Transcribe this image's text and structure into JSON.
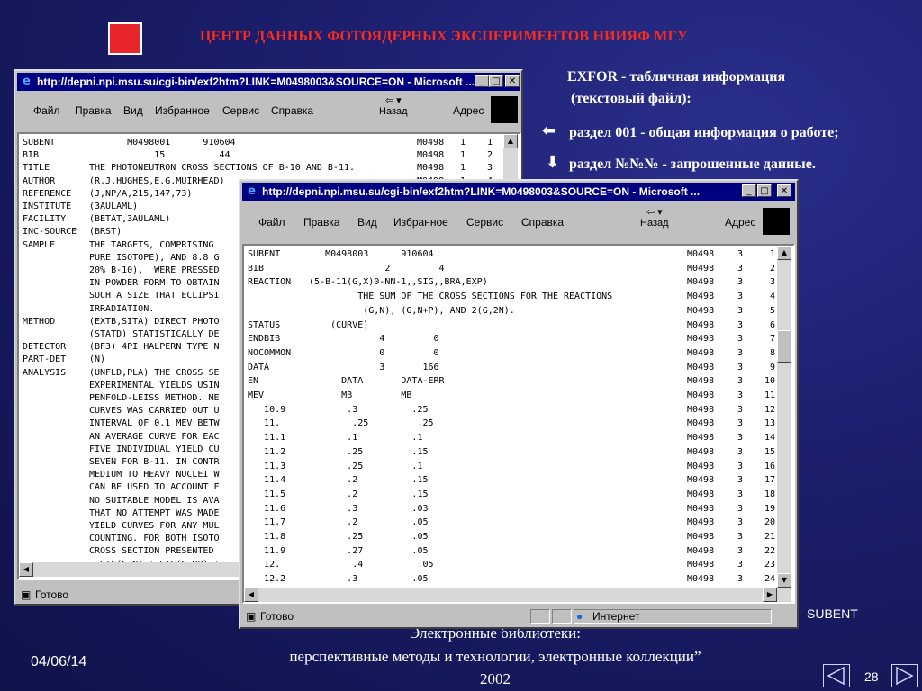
{
  "slide": {
    "title": "ЦЕНТР ДАННЫХ ФОТОЯДЕРНЫХ ЭКСПЕРИМЕНТОВ НИИЯФ МГУ",
    "exfor_line1": "EXFOR - табличная информация",
    "exfor_line2": "(текстовый файл):",
    "bullet1": "раздел 001 - общая информация о работе;",
    "bullet2": "раздел №№№ - запрошенные данные.",
    "subent_label": "SUBENT",
    "footer_line1": "Электронные библиотеки:",
    "footer_line2": "перспективные методы и технологии, электронные коллекции”",
    "footer_line3": "2002",
    "date": "04/06/14",
    "page": "28",
    "colors": {
      "title": "#ff2a1a",
      "background": "#1c1f6e",
      "titlebar": "#000080"
    }
  },
  "window1": {
    "title": "http://depni.npi.msu.su/cgi-bin/exf2htm?LINK=M0498003&SOURCE=ON - Microsoft ...",
    "menu": [
      "Файл",
      "Правка",
      "Вид",
      "Избранное",
      "Сервис",
      "Справка"
    ],
    "back": "Назад",
    "address": "Адрес",
    "status": "Готово",
    "rows": [
      [
        "SUBENT",
        "       M0498001      910604",
        "M0498",
        "1",
        "1"
      ],
      [
        "BIB",
        "            15          44",
        "M0498",
        "1",
        "2"
      ],
      [
        "TITLE",
        "THE PHOTONEUTRON CROSS SECTIONS OF B-10 AND B-11.",
        "M0498",
        "1",
        "3"
      ],
      [
        "AUTHOR",
        "(R.J.HUGHES,E.G.MUIRHEAD)",
        "M0498",
        "1",
        "4"
      ],
      [
        "REFERENCE",
        "(J,NP/A,215,147,73)",
        "",
        "",
        ""
      ],
      [
        "INSTITUTE",
        "(3AULAML)",
        "",
        "",
        ""
      ],
      [
        "FACILITY",
        "(BETAT,3AULAML)",
        "",
        "",
        ""
      ],
      [
        "INC-SOURCE",
        "(BRST)",
        "",
        "",
        ""
      ],
      [
        "SAMPLE",
        "THE TARGETS, COMPRISING",
        "",
        "",
        ""
      ],
      [
        "",
        "PURE ISOTOPE), AND 8.8 G",
        "",
        "",
        ""
      ],
      [
        "",
        "20% B-10),  WERE PRESSED",
        "",
        "",
        ""
      ],
      [
        "",
        "IN POWDER FORM TO OBTAIN",
        "",
        "",
        ""
      ],
      [
        "",
        "SUCH A SIZE THAT ECLIPSI",
        "",
        "",
        ""
      ],
      [
        "",
        "IRRADIATION.",
        "",
        "",
        ""
      ],
      [
        "METHOD",
        "(EXTB,SITA) DIRECT PHOTO",
        "",
        "",
        ""
      ],
      [
        "",
        "(STATD) STATISTICALLY DE",
        "",
        "",
        ""
      ],
      [
        "DETECTOR",
        "(BF3) 4PI HALPERN TYPE N",
        "",
        "",
        ""
      ],
      [
        "PART-DET",
        "(N)",
        "",
        "",
        ""
      ],
      [
        "ANALYSIS",
        "(UNFLD,PLA) THE CROSS SE",
        "",
        "",
        ""
      ],
      [
        "",
        "EXPERIMENTAL YIELDS USIN",
        "",
        "",
        ""
      ],
      [
        "",
        "PENFOLD-LEISS METHOD. ME",
        "",
        "",
        ""
      ],
      [
        "",
        "CURVES WAS CARRIED OUT U",
        "",
        "",
        ""
      ],
      [
        "",
        "INTERVAL OF 0.1 MEV BETW",
        "",
        "",
        ""
      ],
      [
        "",
        "AN AVERAGE CURVE FOR EAC",
        "",
        "",
        ""
      ],
      [
        "",
        "FIVE INDIVIDUAL YIELD CU",
        "",
        "",
        ""
      ],
      [
        "",
        "SEVEN FOR B-11. IN CONTR",
        "",
        "",
        ""
      ],
      [
        "",
        "MEDIUM TO HEAVY NUCLEI W",
        "",
        "",
        ""
      ],
      [
        "",
        "CAN BE USED TO ACCOUNT F",
        "",
        "",
        ""
      ],
      [
        "",
        "NO SUITABLE MODEL IS AVA",
        "",
        "",
        ""
      ],
      [
        "",
        "THAT NO ATTEMPT WAS MADE",
        "",
        "",
        ""
      ],
      [
        "",
        "YIELD CURVES FOR ANY MUL",
        "",
        "",
        ""
      ],
      [
        "",
        "COUNTING. FOR BOTH ISOTO",
        "",
        "",
        ""
      ],
      [
        "",
        "CROSS SECTION PRESENTED",
        "",
        "",
        ""
      ],
      [
        "",
        "= SIG(G,N) + SIG(G,NP) +",
        "",
        "",
        ""
      ]
    ]
  },
  "window2": {
    "title": "http://depni.npi.msu.su/cgi-bin/exf2htm?LINK=M0498003&SOURCE=ON - Microsoft ...",
    "menu": [
      "Файл",
      "Правка",
      "Вид",
      "Избранное",
      "Сервис",
      "Справка"
    ],
    "back": "Назад",
    "address": "Адрес",
    "status": "Готово",
    "zone": "Интернет",
    "rows": [
      [
        "SUBENT",
        "     M0498003      910604",
        "M0498",
        "3",
        "1"
      ],
      [
        "BIB",
        "                2         4",
        "M0498",
        "3",
        "2"
      ],
      [
        "REACTION",
        "  (5-B-11(G,X)0-NN-1,,SIG,,BRA,EXP)",
        "M0498",
        "3",
        "3"
      ],
      [
        "",
        "           THE SUM OF THE CROSS SECTIONS FOR THE REACTIONS",
        "M0498",
        "3",
        "4"
      ],
      [
        "",
        "            (G,N), (G,N+P), AND 2(G,2N).",
        "M0498",
        "3",
        "5"
      ],
      [
        "STATUS",
        "      (CURVE)",
        "M0498",
        "3",
        "6"
      ],
      [
        "ENDBIB",
        "               4         0",
        "M0498",
        "3",
        "7"
      ],
      [
        "NOCOMMON",
        "               0         0",
        "M0498",
        "3",
        "8"
      ],
      [
        "DATA",
        "               3       166",
        "M0498",
        "3",
        "9"
      ],
      [
        "EN",
        "        DATA       DATA-ERR",
        "M0498",
        "3",
        "10"
      ],
      [
        "MEV",
        "        MB         MB",
        "M0498",
        "3",
        "11"
      ],
      [
        "   10.9",
        "         .3          .25",
        "M0498",
        "3",
        "12"
      ],
      [
        "   11.",
        "          .25         .25",
        "M0498",
        "3",
        "13"
      ],
      [
        "   11.1",
        "         .1          .1",
        "M0498",
        "3",
        "14"
      ],
      [
        "   11.2",
        "         .25         .15",
        "M0498",
        "3",
        "15"
      ],
      [
        "   11.3",
        "         .25         .1",
        "M0498",
        "3",
        "16"
      ],
      [
        "   11.4",
        "         .2          .15",
        "M0498",
        "3",
        "17"
      ],
      [
        "   11.5",
        "         .2          .15",
        "M0498",
        "3",
        "18"
      ],
      [
        "   11.6",
        "         .3          .03",
        "M0498",
        "3",
        "19"
      ],
      [
        "   11.7",
        "         .2          .05",
        "M0498",
        "3",
        "20"
      ],
      [
        "   11.8",
        "         .25         .05",
        "M0498",
        "3",
        "21"
      ],
      [
        "   11.9",
        "         .27         .05",
        "M0498",
        "3",
        "22"
      ],
      [
        "   12.",
        "          .4          .05",
        "M0498",
        "3",
        "23"
      ],
      [
        "   12.2",
        "         .3          .05",
        "M0498",
        "3",
        "24"
      ]
    ]
  }
}
